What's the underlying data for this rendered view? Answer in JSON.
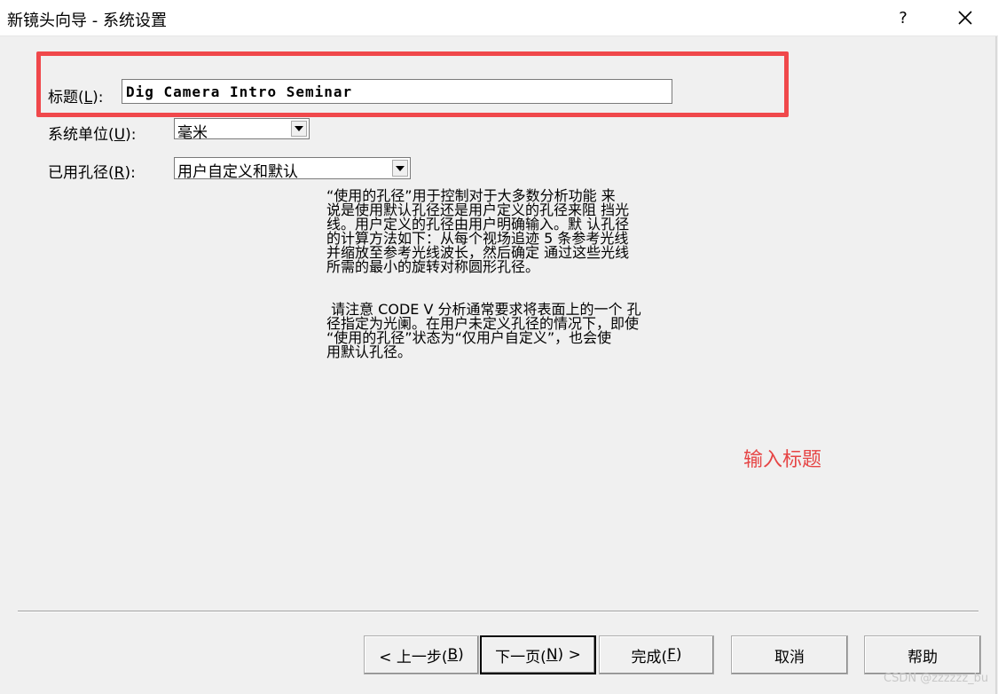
{
  "window": {
    "title": "新镜头向导 - 系统设置",
    "help_label": "?"
  },
  "form": {
    "title_label": "标题(",
    "title_mnemonic": "L",
    "title_label_end": "):",
    "title_value": "Dig Camera Intro Seminar",
    "units_label": "系统单位(",
    "units_mnemonic": "U",
    "units_label_end": "):",
    "units_value": "毫米",
    "aperture_label": "已用孔径(",
    "aperture_mnemonic": "R",
    "aperture_label_end": "):",
    "aperture_value": "用户自定义和默认"
  },
  "description": {
    "paragraph1": "“使用的孔径”用于控制对于大多数分析功能 来\n说是使用默认孔径还是用户定义的孔径来阻 挡光\n线。用户定义的孔径由用户明确输入。默 认孔径\n的计算方法如下：从每个视场追迹 5 条参考光线\n并缩放至参考光线波长，然后确定 通过这些光线\n所需的最小的旋转对称圆形孔径。",
    "paragraph2": " 请注意 CODE V 分析通常要求将表面上的一个 孔\n径指定为光阑。在用户未定义孔径的情况下，即使\n“使用的孔径”状态为“仅用户自定义”，也会使\n用默认孔径。"
  },
  "annotation": "输入标题",
  "buttons": {
    "back_prefix": "< 上一步(",
    "back_mnemonic": "B",
    "back_suffix": ")",
    "next_prefix": "下一页(",
    "next_mnemonic": "N",
    "next_suffix": ") >",
    "finish_prefix": "完成(",
    "finish_mnemonic": "F",
    "finish_suffix": ")",
    "cancel": "取消",
    "help": "帮助"
  },
  "watermark": "CSDN @zzzzzz_bu",
  "colors": {
    "highlight": "#f0484b",
    "annotation": "#e64545"
  }
}
